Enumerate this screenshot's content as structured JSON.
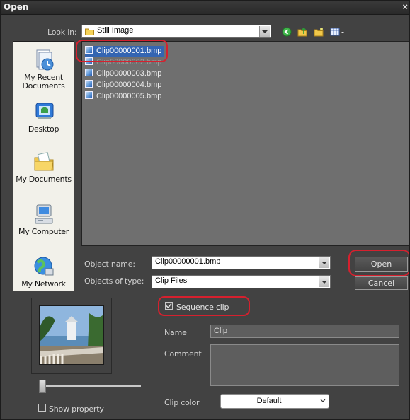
{
  "window": {
    "title": "Open",
    "close_glyph": "×"
  },
  "look_in": {
    "label": "Look in:",
    "value": "Still Image"
  },
  "toolbar": {
    "icons": [
      "back-icon",
      "up-folder-icon",
      "new-folder-icon",
      "views-menu-icon"
    ]
  },
  "places": [
    {
      "label": "My Recent Documents",
      "icon": "recent-documents-icon"
    },
    {
      "label": "Desktop",
      "icon": "desktop-icon"
    },
    {
      "label": "My Documents",
      "icon": "my-documents-icon"
    },
    {
      "label": "My Computer",
      "icon": "my-computer-icon"
    },
    {
      "label": "My Network",
      "icon": "my-network-icon"
    }
  ],
  "files": [
    {
      "name": "Clip00000001.bmp",
      "selected": true
    },
    {
      "name": "Clip00000002.bmp",
      "selected": false
    },
    {
      "name": "Clip00000003.bmp",
      "selected": false
    },
    {
      "name": "Clip00000004.bmp",
      "selected": false
    },
    {
      "name": "Clip00000005.bmp",
      "selected": false
    }
  ],
  "object_name": {
    "label": "Object name:",
    "value": "Clip00000001.bmp"
  },
  "object_type": {
    "label": "Objects of type:",
    "value": "Clip Files"
  },
  "buttons": {
    "open": "Open",
    "cancel": "Cancel"
  },
  "sequence_clip": {
    "label": "Sequence clip",
    "checked": true
  },
  "properties": {
    "name_label": "Name",
    "name_value": "Clip",
    "comment_label": "Comment",
    "comment_value": "",
    "clip_color_label": "Clip color",
    "clip_color_value": "Default"
  },
  "show_property": {
    "label": "Show property",
    "checked": false
  },
  "colors": {
    "highlight": "#d6202e",
    "selection": "#3465b2",
    "dialog_bg": "#424242"
  }
}
